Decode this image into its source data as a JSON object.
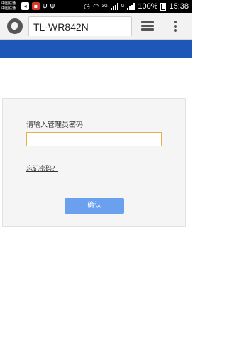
{
  "status_bar": {
    "carrier_line1": "中国联通",
    "carrier_line2": "中国联通",
    "network_label": "3G",
    "g_label": "G",
    "battery": "100%",
    "time": "15:38"
  },
  "browser": {
    "url": "TL-WR842N"
  },
  "login": {
    "prompt": "请输入管理员密码",
    "password_value": "",
    "forgot_link": "忘记密码？",
    "confirm_button": "确认"
  },
  "colors": {
    "header_band": "#1e57b8",
    "confirm_button": "#6aa0ee",
    "input_focus_border": "#e5b04a"
  }
}
